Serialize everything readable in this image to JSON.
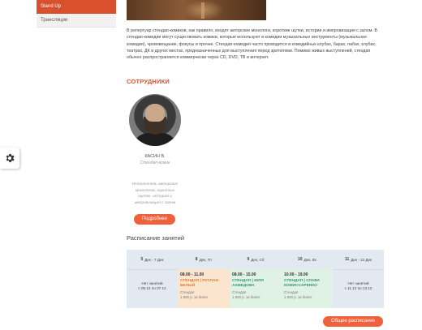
{
  "sidebar": {
    "items": [
      {
        "label": "Stand Up",
        "active": true
      },
      {
        "label": "Трансляции",
        "active": false
      }
    ]
  },
  "settings": {
    "icon": "gear-icon"
  },
  "description": "В репертуар стендап-комиков, как правило, входят авторские монологи, короткие шутки, истории и импровизация с залом. В стендап-комедии могут существовать комики, которые используют в комедии музыкальные инструменты (музыкальная комедия), чревовещание, фокусы и прочее. Стендап-комедия часто проводится в комедийных клубах, барах, пабах, клубах, театрах, ДК и других местах, предназначенных для выступления перед зрителями. Помимо живых выступлений, стендап обычно распространяется коммерчески через CD, DVD, ТВ и интернет.",
  "staff": {
    "title": "СОТРУДНИКИ",
    "employee": {
      "name": "КАСИН В.",
      "role": "Стендап-комик",
      "bio": "Исполнитель авторских монологов, коротких шуток, историй и импровизаций с залом"
    },
    "more_label": "Подробнее"
  },
  "schedule": {
    "title": "Расписание занятий",
    "days": [
      {
        "num": "5",
        "label": "Дек - 7 Дек",
        "empty": true,
        "empty_text": "Нет занятий",
        "empty_until": "c 05.12 по 07.12"
      },
      {
        "num": "8",
        "label": "Дек, Пт",
        "empty": false,
        "color": "orange",
        "time": "08.00 - 11.00",
        "name": "СТЕНДАП | РУСЛАН БЕЛЫЙ",
        "type": "Стендап",
        "price": "1 500 р. за билет"
      },
      {
        "num": "9",
        "label": "Дек, Сб",
        "empty": false,
        "color": "green",
        "time": "08.00 - 15.00",
        "name": "СТЕНДАП | ЮЛЯ АХМЕДОВА",
        "type": "Стендап",
        "price": "1 500 р. за билет"
      },
      {
        "num": "10",
        "label": "Дек, Вс",
        "empty": false,
        "color": "green",
        "time": "10.00 - 19.00",
        "name": "СТЕНДАП | СЛАВА КОМИССАРЕНКО",
        "type": "Стендап",
        "price": "1 500 р. за билет"
      },
      {
        "num": "11",
        "label": "Дек - 13 Дек",
        "empty": true,
        "empty_text": "Нет занятий",
        "empty_until": "c 11.12 по 13.12"
      }
    ],
    "all_label": "Общее расписание"
  }
}
